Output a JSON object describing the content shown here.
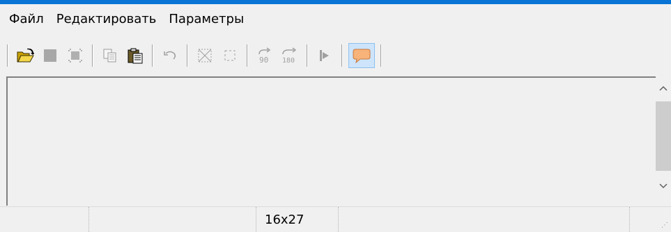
{
  "menubar": {
    "items": [
      {
        "label": "Файл"
      },
      {
        "label": "Редактировать"
      },
      {
        "label": "Параметры"
      }
    ]
  },
  "toolbar": {
    "buttons": [
      {
        "icon": "open-folder-icon",
        "enabled": true
      },
      {
        "icon": "stop-icon",
        "enabled": false
      },
      {
        "icon": "select-frame-icon",
        "enabled": false
      },
      {
        "icon": "copy-icon",
        "enabled": false
      },
      {
        "icon": "paste-icon",
        "enabled": true
      },
      {
        "icon": "undo-icon",
        "enabled": false
      },
      {
        "icon": "crop-icon",
        "enabled": false
      },
      {
        "icon": "selection-rect-icon",
        "enabled": false
      },
      {
        "icon": "rotate-90-icon",
        "enabled": false
      },
      {
        "icon": "rotate-180-icon",
        "enabled": false
      },
      {
        "icon": "play-forward-icon",
        "enabled": false
      },
      {
        "icon": "speech-bubble-icon",
        "enabled": true,
        "active": true
      }
    ]
  },
  "statusbar": {
    "cells": [
      "",
      "",
      "16x27",
      "",
      ""
    ]
  },
  "colors": {
    "accent_strip": "#0a74d6",
    "active_button_bg": "#cde4fb",
    "active_button_border": "#8ec0ee",
    "bubble_fill": "#f7b37a"
  }
}
